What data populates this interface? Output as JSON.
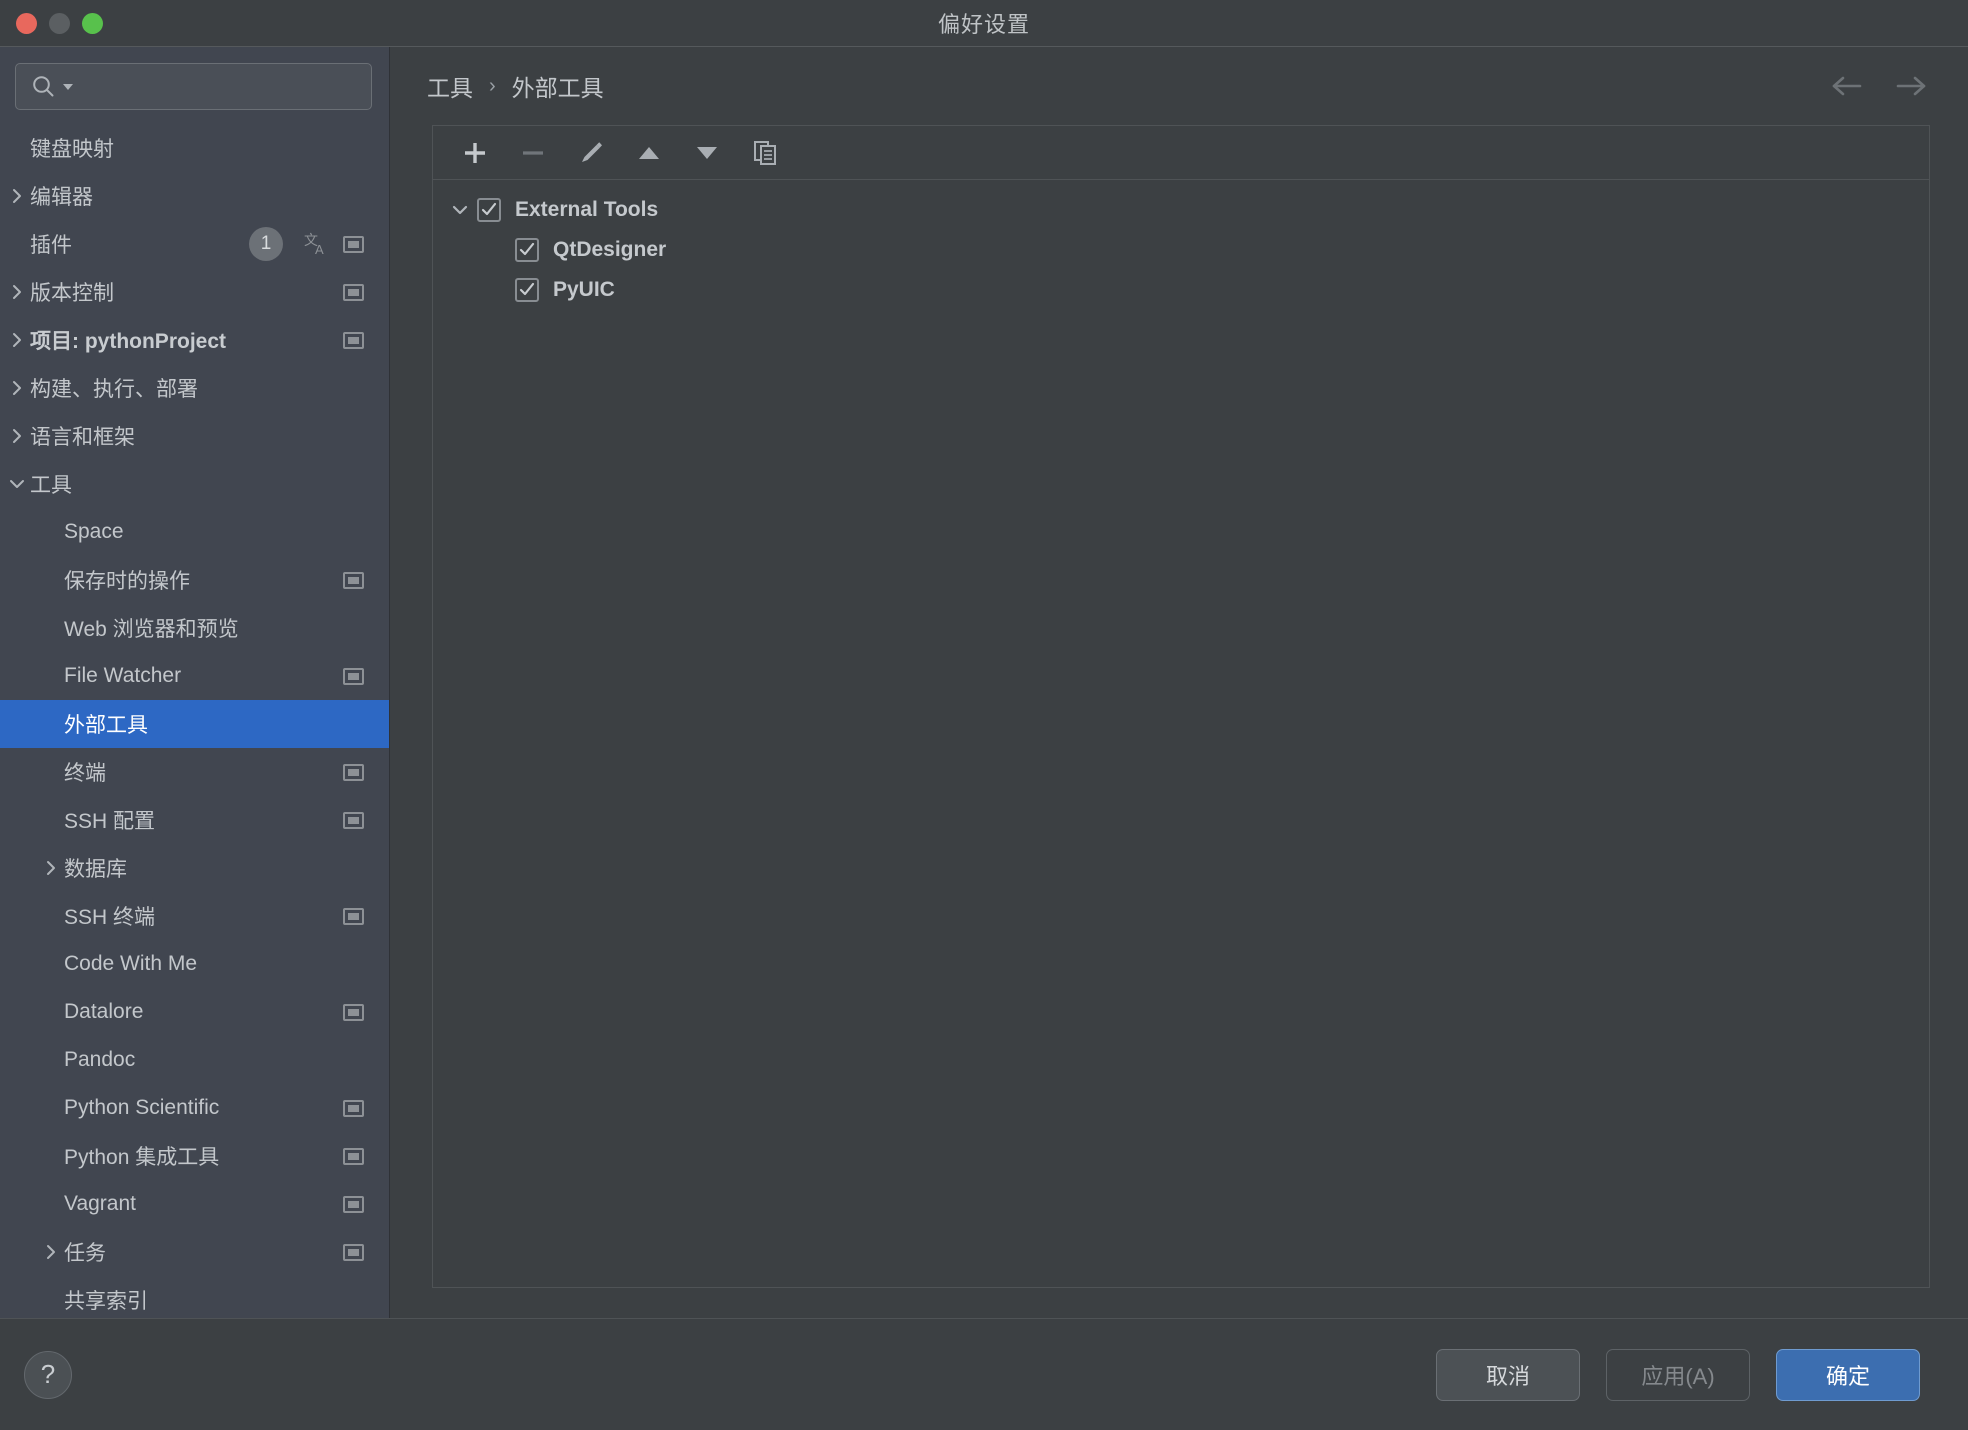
{
  "window": {
    "title": "偏好设置",
    "traffic_lights": [
      "close",
      "minimize",
      "maximize"
    ]
  },
  "sidebar": {
    "search": {
      "value": "",
      "placeholder": ""
    },
    "items": [
      {
        "label": "键盘映射",
        "level": 0,
        "arrow": "none",
        "bold": false,
        "badge": null,
        "pane_icon": false
      },
      {
        "label": "编辑器",
        "level": 0,
        "arrow": "right",
        "bold": false,
        "badge": null,
        "pane_icon": false
      },
      {
        "label": "插件",
        "level": 0,
        "arrow": "none",
        "bold": false,
        "badge": "1",
        "pane_icon": true,
        "translate_icon": true
      },
      {
        "label": "版本控制",
        "level": 0,
        "arrow": "right",
        "bold": false,
        "badge": null,
        "pane_icon": true
      },
      {
        "label": "项目: pythonProject",
        "level": 0,
        "arrow": "right",
        "bold": true,
        "badge": null,
        "pane_icon": true
      },
      {
        "label": "构建、执行、部署",
        "level": 0,
        "arrow": "right",
        "bold": false,
        "badge": null,
        "pane_icon": false
      },
      {
        "label": "语言和框架",
        "level": 0,
        "arrow": "right",
        "bold": false,
        "badge": null,
        "pane_icon": false
      },
      {
        "label": "工具",
        "level": 0,
        "arrow": "down",
        "bold": false,
        "badge": null,
        "pane_icon": false
      },
      {
        "label": "Space",
        "level": 1,
        "arrow": "none",
        "bold": false,
        "badge": null,
        "pane_icon": false
      },
      {
        "label": "保存时的操作",
        "level": 1,
        "arrow": "none",
        "bold": false,
        "badge": null,
        "pane_icon": true
      },
      {
        "label": "Web 浏览器和预览",
        "level": 1,
        "arrow": "none",
        "bold": false,
        "badge": null,
        "pane_icon": false
      },
      {
        "label": "File Watcher",
        "level": 1,
        "arrow": "none",
        "bold": false,
        "badge": null,
        "pane_icon": true
      },
      {
        "label": "外部工具",
        "level": 1,
        "arrow": "none",
        "bold": false,
        "badge": null,
        "pane_icon": false,
        "selected": true
      },
      {
        "label": "终端",
        "level": 1,
        "arrow": "none",
        "bold": false,
        "badge": null,
        "pane_icon": true
      },
      {
        "label": "SSH 配置",
        "level": 1,
        "arrow": "none",
        "bold": false,
        "badge": null,
        "pane_icon": true
      },
      {
        "label": "数据库",
        "level": 1,
        "arrow": "right",
        "bold": false,
        "badge": null,
        "pane_icon": false
      },
      {
        "label": "SSH 终端",
        "level": 1,
        "arrow": "none",
        "bold": false,
        "badge": null,
        "pane_icon": true
      },
      {
        "label": "Code With Me",
        "level": 1,
        "arrow": "none",
        "bold": false,
        "badge": null,
        "pane_icon": false
      },
      {
        "label": "Datalore",
        "level": 1,
        "arrow": "none",
        "bold": false,
        "badge": null,
        "pane_icon": true
      },
      {
        "label": "Pandoc",
        "level": 1,
        "arrow": "none",
        "bold": false,
        "badge": null,
        "pane_icon": false
      },
      {
        "label": "Python Scientific",
        "level": 1,
        "arrow": "none",
        "bold": false,
        "badge": null,
        "pane_icon": true
      },
      {
        "label": "Python 集成工具",
        "level": 1,
        "arrow": "none",
        "bold": false,
        "badge": null,
        "pane_icon": true
      },
      {
        "label": "Vagrant",
        "level": 1,
        "arrow": "none",
        "bold": false,
        "badge": null,
        "pane_icon": true
      },
      {
        "label": "任务",
        "level": 1,
        "arrow": "right",
        "bold": false,
        "badge": null,
        "pane_icon": true
      },
      {
        "label": "共享索引",
        "level": 1,
        "arrow": "none",
        "bold": false,
        "badge": null,
        "pane_icon": false
      }
    ]
  },
  "main": {
    "breadcrumb": {
      "parent": "工具",
      "separator": "›",
      "current": "外部工具"
    },
    "nav": {
      "back": "back-arrow",
      "forward": "forward-arrow"
    },
    "toolbar": [
      {
        "name": "add",
        "icon": "plus-icon",
        "enabled": true
      },
      {
        "name": "remove",
        "icon": "minus-icon",
        "enabled": false
      },
      {
        "name": "edit",
        "icon": "pencil-icon",
        "enabled": true
      },
      {
        "name": "move-up",
        "icon": "arrow-up-icon",
        "enabled": true
      },
      {
        "name": "move-down",
        "icon": "arrow-down-icon",
        "enabled": true
      },
      {
        "name": "copy",
        "icon": "copy-icon",
        "enabled": true
      }
    ],
    "tools_tree": [
      {
        "label": "External Tools",
        "level": 0,
        "checked": true,
        "expanded": true
      },
      {
        "label": "QtDesigner",
        "level": 1,
        "checked": true,
        "expanded": null
      },
      {
        "label": "PyUIC",
        "level": 1,
        "checked": true,
        "expanded": null
      }
    ]
  },
  "footer": {
    "help_label": "?",
    "cancel_label": "取消",
    "apply_label": "应用(A)",
    "ok_label": "确定"
  },
  "colors": {
    "accent": "#2d68c4",
    "primary_button": "#3c6eb0",
    "sidebar_bg": "#414650",
    "main_bg": "#3c4043",
    "title_bg": "#3c4043",
    "close": "#e8685d",
    "minimize": "#5b5f62",
    "maximize": "#58c14c"
  }
}
